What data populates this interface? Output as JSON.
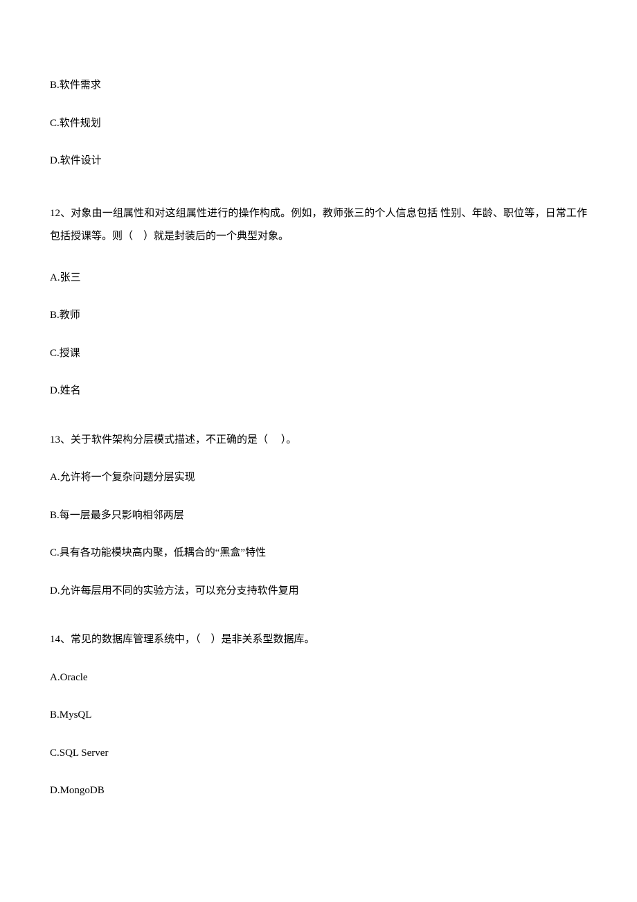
{
  "partial_question_11": {
    "options": {
      "b": "B.软件需求",
      "c": "C.软件规划",
      "d": "D.软件设计"
    }
  },
  "question_12": {
    "stem": "12、对象由一组属性和对这组属性进行的操作构成。例如，教师张三的个人信息包括 性别、年龄、职位等，日常工作包括授课等。则（　）就是封装后的一个典型对象。",
    "options": {
      "a": "A.张三",
      "b": "B.教师",
      "c": "C.授课",
      "d": "D.姓名"
    }
  },
  "question_13": {
    "stem": "13、关于软件架构分层模式描述，不正确的是（　 ）。",
    "options": {
      "a": "A.允许将一个复杂问题分层实现",
      "b": "B.每一层最多只影响相邻两层",
      "c": "C.具有各功能模块高内聚，低耦合的“黑盒”特性",
      "d": "D.允许每层用不同的实验方法，可以充分支持软件复用"
    }
  },
  "question_14": {
    "stem": "14、常见的数据库管理系统中，（　）是非关系型数据库。",
    "options": {
      "a": "A.Oracle",
      "b": "B.MysQL",
      "c": "C.SQL Server",
      "d": "D.MongoDB"
    }
  }
}
